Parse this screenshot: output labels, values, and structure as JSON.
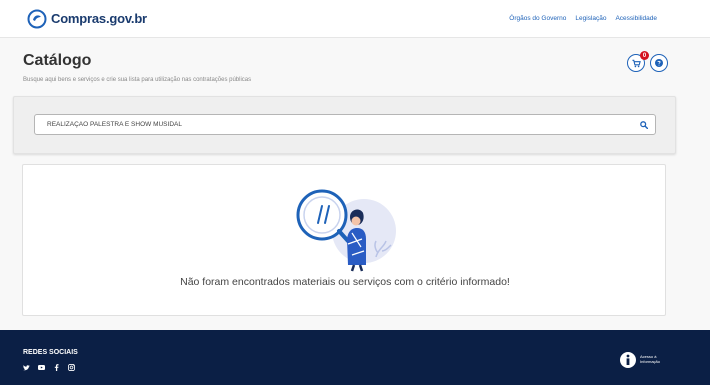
{
  "header": {
    "logo_text": "Compras.gov.br",
    "nav": [
      "Órgãos do Governo",
      "Legislação",
      "Acessibilidade"
    ]
  },
  "page": {
    "title": "Catálogo",
    "subtitle": "Busque aqui bens e serviços e crie sua lista para utilização nas contratações públicas"
  },
  "cart": {
    "badge_count": "0"
  },
  "search": {
    "value": "REALIZAÇÃO PALESTRA E SHOW MUSIDAL"
  },
  "results": {
    "empty_message": "Não foram encontrados materiais ou serviços com o critério informado!"
  },
  "footer": {
    "social_title": "REDES SOCIAIS",
    "social_icons": [
      "twitter-icon",
      "youtube-icon",
      "facebook-icon",
      "instagram-icon"
    ],
    "access_info": "Acesso à Informação"
  },
  "colors": {
    "primary": "#1e62b8",
    "brand_dark": "#1a3b6e",
    "footer_bg": "#0b1f45",
    "badge": "#d4121f"
  }
}
